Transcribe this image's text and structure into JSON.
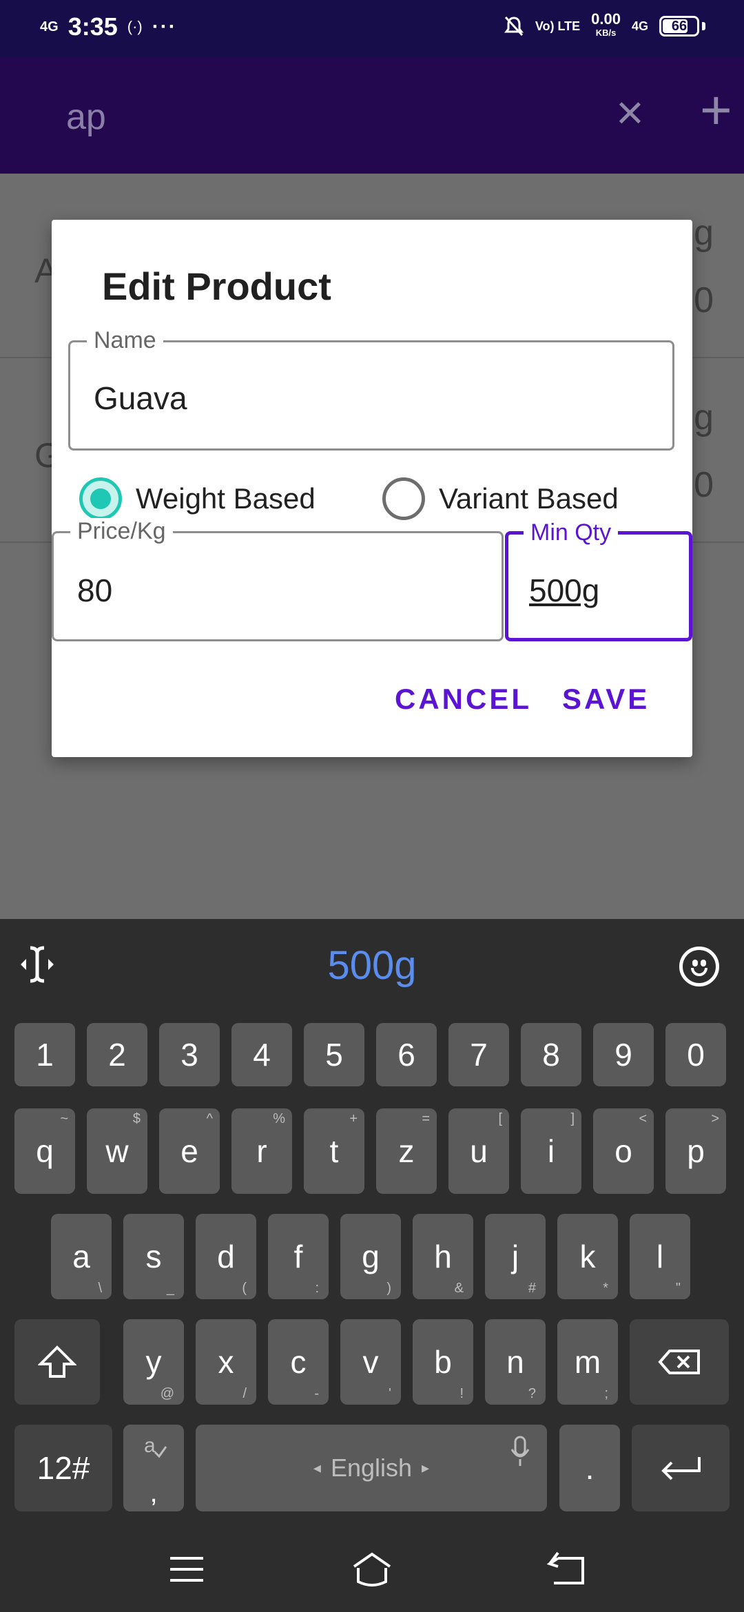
{
  "status_bar": {
    "network": "4G",
    "time": "3:35",
    "hotspot": "(·)",
    "more": "···",
    "volte": "Vo) LTE",
    "speed_value": "0.00",
    "speed_unit": "KB/s",
    "network_right": "4G",
    "battery": "66"
  },
  "toolbar": {
    "search_text": "ap",
    "close_label": "×",
    "add_label": "+"
  },
  "background_list": {
    "rows": [
      {
        "letter": "A",
        "right_top": "g",
        "right_bottom": "0"
      },
      {
        "letter": "G",
        "right_top": "g",
        "right_bottom": "0"
      }
    ]
  },
  "dialog": {
    "title": "Edit Product",
    "name_label": "Name",
    "name_value": "Guava",
    "radio_weight": "Weight Based",
    "radio_variant": "Variant Based",
    "weight_selected": true,
    "price_label": "Price/Kg",
    "price_value": "80",
    "minqty_label": "Min Qty",
    "minqty_value": "500g",
    "cancel": "CANCEL",
    "save": "SAVE"
  },
  "keyboard": {
    "suggestion": "500g",
    "number_row": [
      "1",
      "2",
      "3",
      "4",
      "5",
      "6",
      "7",
      "8",
      "9",
      "0"
    ],
    "row1": [
      {
        "k": "q",
        "s": "~"
      },
      {
        "k": "w",
        "s": "$"
      },
      {
        "k": "e",
        "s": "^"
      },
      {
        "k": "r",
        "s": "%"
      },
      {
        "k": "t",
        "s": "+"
      },
      {
        "k": "z",
        "s": "="
      },
      {
        "k": "u",
        "s": "["
      },
      {
        "k": "i",
        "s": "]"
      },
      {
        "k": "o",
        "s": "<"
      },
      {
        "k": "p",
        "s": ">"
      }
    ],
    "row2": [
      {
        "k": "a",
        "s": "\\"
      },
      {
        "k": "s",
        "s": "_"
      },
      {
        "k": "d",
        "s": "("
      },
      {
        "k": "f",
        "s": ":"
      },
      {
        "k": "g",
        "s": ")"
      },
      {
        "k": "h",
        "s": "&"
      },
      {
        "k": "j",
        "s": "#"
      },
      {
        "k": "k",
        "s": "*"
      },
      {
        "k": "l",
        "s": "\""
      }
    ],
    "row3": [
      {
        "k": "y",
        "s": "@"
      },
      {
        "k": "x",
        "s": "/"
      },
      {
        "k": "c",
        "s": "-"
      },
      {
        "k": "v",
        "s": "'"
      },
      {
        "k": "b",
        "s": "!"
      },
      {
        "k": "n",
        "s": "?"
      },
      {
        "k": "m",
        "s": ";"
      }
    ],
    "symbols_key": "12#",
    "comma_key": ",",
    "space_label": "English",
    "period_key": "."
  },
  "icons": [
    "text-cursor-icon",
    "emoji-icon",
    "shift-icon",
    "backspace-icon",
    "enter-icon",
    "mic-icon",
    "menu-icon",
    "home-icon",
    "back-icon"
  ]
}
